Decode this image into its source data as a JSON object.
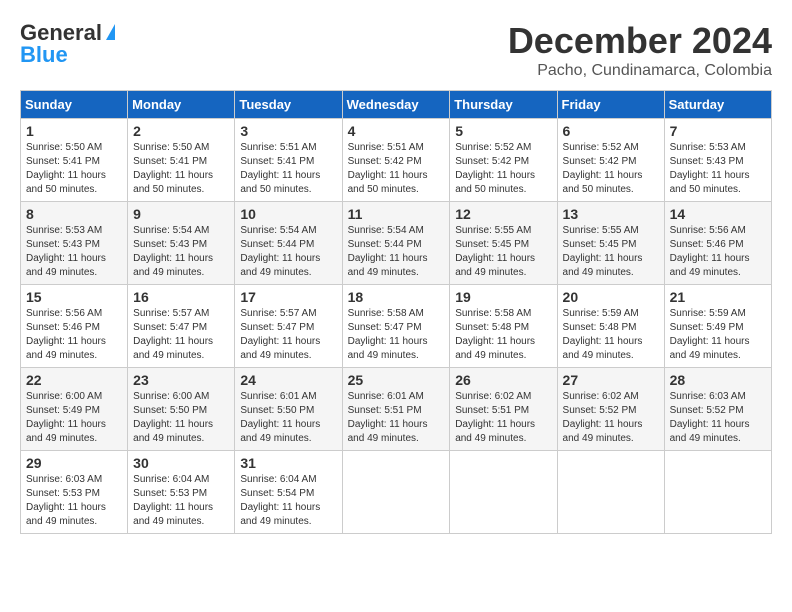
{
  "header": {
    "logo_general": "General",
    "logo_blue": "Blue",
    "month_title": "December 2024",
    "location": "Pacho, Cundinamarca, Colombia"
  },
  "weekdays": [
    "Sunday",
    "Monday",
    "Tuesday",
    "Wednesday",
    "Thursday",
    "Friday",
    "Saturday"
  ],
  "weeks": [
    [
      {
        "day": "1",
        "sunrise": "5:50 AM",
        "sunset": "5:41 PM",
        "daylight": "11 hours and 50 minutes."
      },
      {
        "day": "2",
        "sunrise": "5:50 AM",
        "sunset": "5:41 PM",
        "daylight": "11 hours and 50 minutes."
      },
      {
        "day": "3",
        "sunrise": "5:51 AM",
        "sunset": "5:41 PM",
        "daylight": "11 hours and 50 minutes."
      },
      {
        "day": "4",
        "sunrise": "5:51 AM",
        "sunset": "5:42 PM",
        "daylight": "11 hours and 50 minutes."
      },
      {
        "day": "5",
        "sunrise": "5:52 AM",
        "sunset": "5:42 PM",
        "daylight": "11 hours and 50 minutes."
      },
      {
        "day": "6",
        "sunrise": "5:52 AM",
        "sunset": "5:42 PM",
        "daylight": "11 hours and 50 minutes."
      },
      {
        "day": "7",
        "sunrise": "5:53 AM",
        "sunset": "5:43 PM",
        "daylight": "11 hours and 50 minutes."
      }
    ],
    [
      {
        "day": "8",
        "sunrise": "5:53 AM",
        "sunset": "5:43 PM",
        "daylight": "11 hours and 49 minutes."
      },
      {
        "day": "9",
        "sunrise": "5:54 AM",
        "sunset": "5:43 PM",
        "daylight": "11 hours and 49 minutes."
      },
      {
        "day": "10",
        "sunrise": "5:54 AM",
        "sunset": "5:44 PM",
        "daylight": "11 hours and 49 minutes."
      },
      {
        "day": "11",
        "sunrise": "5:54 AM",
        "sunset": "5:44 PM",
        "daylight": "11 hours and 49 minutes."
      },
      {
        "day": "12",
        "sunrise": "5:55 AM",
        "sunset": "5:45 PM",
        "daylight": "11 hours and 49 minutes."
      },
      {
        "day": "13",
        "sunrise": "5:55 AM",
        "sunset": "5:45 PM",
        "daylight": "11 hours and 49 minutes."
      },
      {
        "day": "14",
        "sunrise": "5:56 AM",
        "sunset": "5:46 PM",
        "daylight": "11 hours and 49 minutes."
      }
    ],
    [
      {
        "day": "15",
        "sunrise": "5:56 AM",
        "sunset": "5:46 PM",
        "daylight": "11 hours and 49 minutes."
      },
      {
        "day": "16",
        "sunrise": "5:57 AM",
        "sunset": "5:47 PM",
        "daylight": "11 hours and 49 minutes."
      },
      {
        "day": "17",
        "sunrise": "5:57 AM",
        "sunset": "5:47 PM",
        "daylight": "11 hours and 49 minutes."
      },
      {
        "day": "18",
        "sunrise": "5:58 AM",
        "sunset": "5:47 PM",
        "daylight": "11 hours and 49 minutes."
      },
      {
        "day": "19",
        "sunrise": "5:58 AM",
        "sunset": "5:48 PM",
        "daylight": "11 hours and 49 minutes."
      },
      {
        "day": "20",
        "sunrise": "5:59 AM",
        "sunset": "5:48 PM",
        "daylight": "11 hours and 49 minutes."
      },
      {
        "day": "21",
        "sunrise": "5:59 AM",
        "sunset": "5:49 PM",
        "daylight": "11 hours and 49 minutes."
      }
    ],
    [
      {
        "day": "22",
        "sunrise": "6:00 AM",
        "sunset": "5:49 PM",
        "daylight": "11 hours and 49 minutes."
      },
      {
        "day": "23",
        "sunrise": "6:00 AM",
        "sunset": "5:50 PM",
        "daylight": "11 hours and 49 minutes."
      },
      {
        "day": "24",
        "sunrise": "6:01 AM",
        "sunset": "5:50 PM",
        "daylight": "11 hours and 49 minutes."
      },
      {
        "day": "25",
        "sunrise": "6:01 AM",
        "sunset": "5:51 PM",
        "daylight": "11 hours and 49 minutes."
      },
      {
        "day": "26",
        "sunrise": "6:02 AM",
        "sunset": "5:51 PM",
        "daylight": "11 hours and 49 minutes."
      },
      {
        "day": "27",
        "sunrise": "6:02 AM",
        "sunset": "5:52 PM",
        "daylight": "11 hours and 49 minutes."
      },
      {
        "day": "28",
        "sunrise": "6:03 AM",
        "sunset": "5:52 PM",
        "daylight": "11 hours and 49 minutes."
      }
    ],
    [
      {
        "day": "29",
        "sunrise": "6:03 AM",
        "sunset": "5:53 PM",
        "daylight": "11 hours and 49 minutes."
      },
      {
        "day": "30",
        "sunrise": "6:04 AM",
        "sunset": "5:53 PM",
        "daylight": "11 hours and 49 minutes."
      },
      {
        "day": "31",
        "sunrise": "6:04 AM",
        "sunset": "5:54 PM",
        "daylight": "11 hours and 49 minutes."
      },
      null,
      null,
      null,
      null
    ]
  ]
}
